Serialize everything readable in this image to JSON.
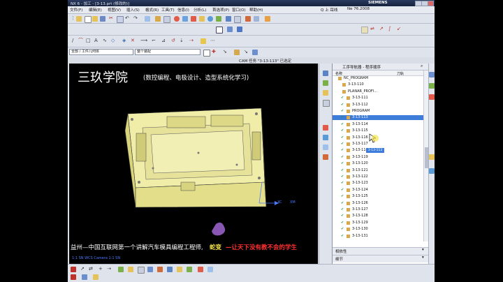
{
  "window": {
    "title": "NX 6 - 加工 - [3-13.prt  (修改的)]",
    "brand": "SIEMENS"
  },
  "menubar": {
    "items": [
      "文件(F)",
      "编辑(E)",
      "视图(V)",
      "插入(S)",
      "格式(R)",
      "工具(T)",
      "信息(I)",
      "分析(L)",
      "首选项(P)",
      "窗口(O)",
      "帮助(H)"
    ],
    "search_label": "Ne 76.2008",
    "search_value": "Q 上 耳线"
  },
  "toolbar_row3": {
    "select_filter": "全部 / 工件几何体",
    "select_scope": "整个装配"
  },
  "graphics": {
    "cam_title": "CAM 任务 \"3-13-113\" 已选定",
    "brand": "三玖学院",
    "brand_sub": "(数控编程、电极设计、造型系统化学习)",
    "ticker_a": "益州—中国互联网第一个讲解汽车模具编程工程师,",
    "ticker_b": "蛇变",
    "ticker_c": "—让天下没有教不会的学生",
    "status": "1:1 SN WCS Camera 1:1 SN",
    "axis_xc": "XC",
    "axis_xm": "XM"
  },
  "navigator": {
    "title": "工序导航器 - 程序顺序",
    "col_name": "名称",
    "col_tool": "刀轨",
    "rows": [
      {
        "label": "NC_PROGRAM",
        "tool": "",
        "check": false
      },
      {
        "label": "3-13-110",
        "tool": "",
        "check": false
      },
      {
        "label": "PLANAR_PROFI...",
        "tool": "",
        "check": false
      },
      {
        "label": "3-13-111",
        "tool": "",
        "check": true
      },
      {
        "label": "3-13-112",
        "tool": "",
        "check": true
      },
      {
        "label": "PROGRAM",
        "tool": "",
        "check": true
      },
      {
        "label": "3-13-113",
        "tool": "",
        "check": true
      },
      {
        "label": "3-13-114",
        "tool": "",
        "check": true
      },
      {
        "label": "3-13-115",
        "tool": "",
        "check": true
      },
      {
        "label": "3-13-116",
        "tool": "",
        "check": true
      },
      {
        "label": "3-13-117",
        "tool": "",
        "check": true
      },
      {
        "label": "3-13-118",
        "tool": "",
        "check": true
      },
      {
        "label": "3-13-119",
        "tool": "",
        "check": true
      },
      {
        "label": "3-13-120",
        "tool": "",
        "check": true
      },
      {
        "label": "3-13-121",
        "tool": "",
        "check": true
      },
      {
        "label": "3-13-122",
        "tool": "",
        "check": true
      },
      {
        "label": "3-13-123",
        "tool": "",
        "check": true
      },
      {
        "label": "3-13-124",
        "tool": "",
        "check": true
      },
      {
        "label": "3-13-125",
        "tool": "",
        "check": true
      },
      {
        "label": "3-13-126",
        "tool": "",
        "check": true
      },
      {
        "label": "3-13-127",
        "tool": "",
        "check": true
      },
      {
        "label": "3-13-128",
        "tool": "",
        "check": true
      },
      {
        "label": "3-13-129",
        "tool": "",
        "check": true
      },
      {
        "label": "3-13-130",
        "tool": "",
        "check": true
      },
      {
        "label": "3-13-131",
        "tool": "",
        "check": true
      }
    ],
    "tooltip": "3-13-113",
    "bottom1": "相依性",
    "bottom2": "细节"
  },
  "colors": {
    "part": "#e9e6a3",
    "selection": "#3d7cd9",
    "check": "#1a9c2a"
  }
}
